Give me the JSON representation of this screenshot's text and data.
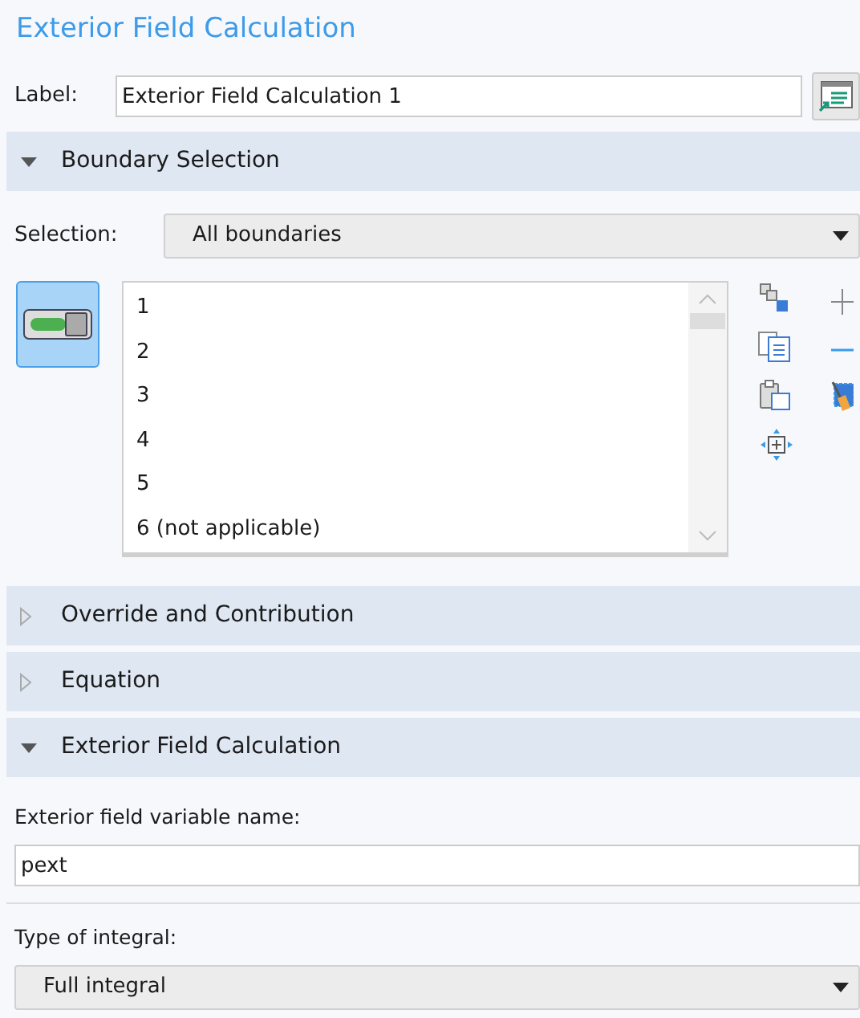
{
  "title": "Exterior Field Calculation",
  "label": {
    "caption": "Label:",
    "value": "Exterior Field Calculation 1"
  },
  "sections": [
    {
      "kind": "selection",
      "title": "Boundary Selection",
      "expanded": true,
      "selection_caption": "Selection:",
      "selection_value": "All boundaries",
      "active_toggle": true,
      "items": [
        "1",
        "2",
        "3",
        "4",
        "5",
        "6 (not applicable)"
      ]
    },
    {
      "title": "Override and Contribution",
      "expanded": false
    },
    {
      "title": "Equation",
      "expanded": false
    },
    {
      "kind": "fields",
      "title": "Exterior Field Calculation",
      "expanded": true,
      "fields": [
        {
          "kind": "text",
          "caption": "Exterior field variable name:",
          "value": "pext"
        },
        {
          "kind": "dropdown",
          "caption": "Type of integral:",
          "value": "Full integral"
        }
      ]
    }
  ]
}
